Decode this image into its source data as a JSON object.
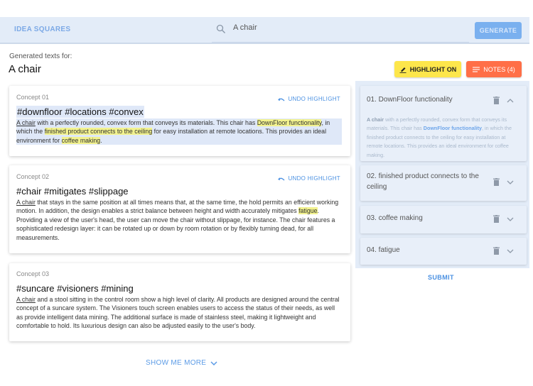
{
  "header": {
    "brand": "IDEA SQUARES",
    "search_value": "A chair",
    "generate_label": "GENERATE"
  },
  "generated": {
    "label": "Generated texts for:",
    "query": "A chair"
  },
  "toolbar": {
    "highlight_label": "HIGHLIGHT ON",
    "notes_label": "NOTES (4)"
  },
  "concepts": [
    {
      "label": "Concept 01",
      "undo_label": "UNDO HIGHLIGHT",
      "tags": "#downfloor #locations #convex",
      "b0": "A chair",
      "b1": " with a perfectly rounded, convex form that conveys its materials. This chair has ",
      "b2": "DownFloor functionality",
      "b3": ", in which the ",
      "b4": "finished product connects to the ceiling",
      "b5": " for easy installation at remote locations. This provides an ideal environment for ",
      "b6": "coffee making",
      "b7": "."
    },
    {
      "label": "Concept 02",
      "undo_label": "UNDO HIGHLIGHT",
      "tags": "#chair #mitigates #slippage",
      "b0": "A chair",
      "b1": " that stays in the same position at all times means that, at the same time, the hold permits an efficient working motion. In addition, the design enables a strict balance between height and width accurately mitigates ",
      "b2": "fatigue",
      "b3": ". Providing a view of the user's head, the user can move the chair without slippage, for instance. The chair features a sophisticated redesign layer: it can be rotated up or down by room rotation or by flexibly turning dead, for all measurements."
    },
    {
      "label": "Concept 03",
      "tags": "#suncare #visioners #mining",
      "b0": "A chair",
      "b1": " and a stool sitting in the control room show a high level of clarity. All products are designed around the central concept of a suncare system. The Visioners touch screen enables users to access the status of their needs, as well as provide intelligent data mining. The additional surface is made of stainless steel, making it lightweight and comfortable to hold. Its luxurious design can also be adjusted easily to the user's body."
    }
  ],
  "notes": [
    {
      "title": "01. DownFloor functionality",
      "expanded": true,
      "p0": "A chair",
      "p1": " with a perfectly rounded, convex form that conveys its materials. This chair has ",
      "p2": "DownFloor functionality",
      "p3": ", in which the finished product connects to the ceiling for easy installation at remote locations. This provides an ideal environment for coffee making."
    },
    {
      "title": "02. finished product connects to the ceiling",
      "expanded": false
    },
    {
      "title": "03. coffee making",
      "expanded": false
    },
    {
      "title": "04. fatigue",
      "expanded": false
    }
  ],
  "submit_label": "SUBMIT",
  "show_more_label": "SHOW ME MORE",
  "icons": [
    "search-icon",
    "highlighter-icon",
    "notes-icon",
    "undo-icon",
    "trash-icon",
    "chevron-up-icon",
    "chevron-down-icon"
  ],
  "colors": {
    "accent": "#4a90e2",
    "highlight_button": "#fde64b",
    "notes_button": "#ff6f47",
    "text_highlight": "#f2f28e",
    "header_bg": "#e3ecf8"
  }
}
